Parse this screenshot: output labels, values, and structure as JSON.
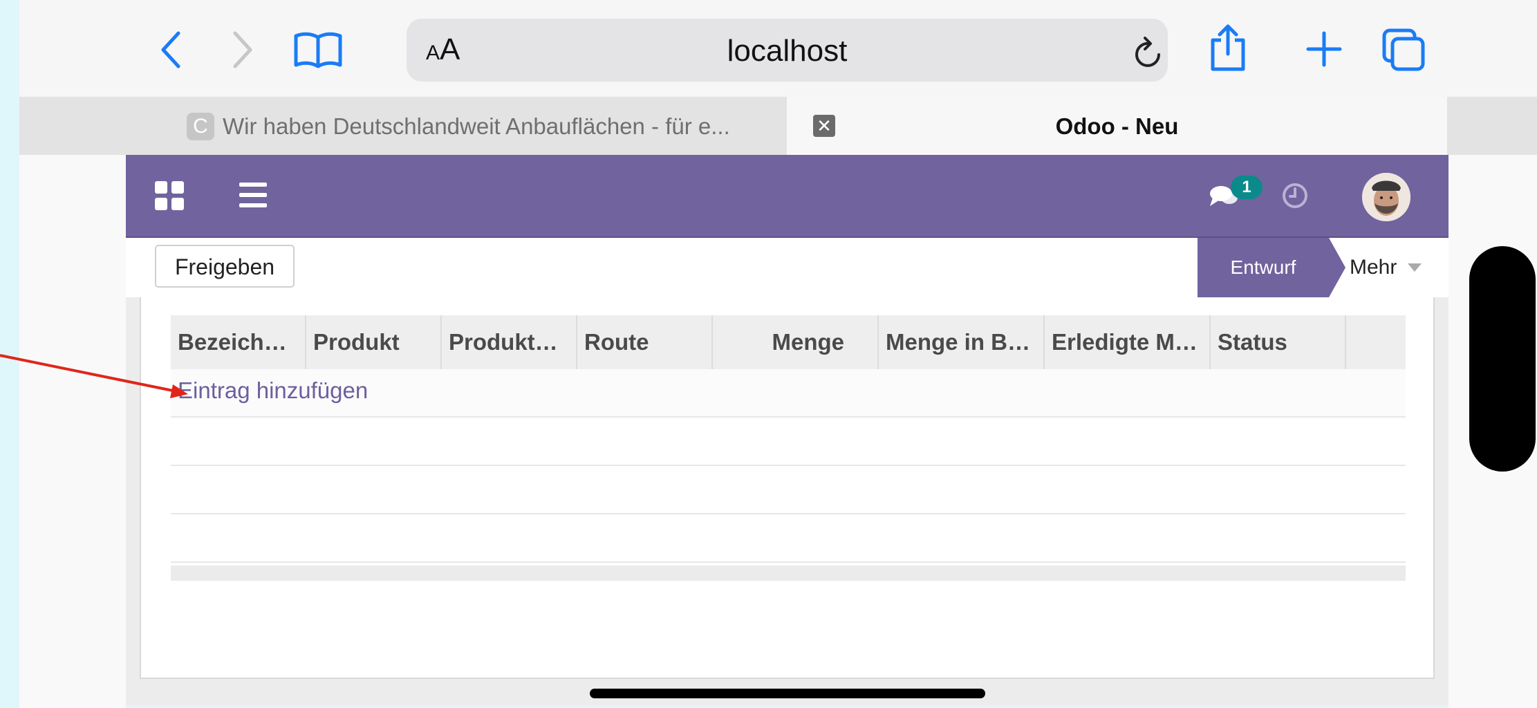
{
  "browser": {
    "url": "localhost",
    "aa_small": "A",
    "aa_large": "A",
    "tabs": [
      {
        "favicon_letter": "C",
        "title": "Wir haben Deutschlandweit Anbauflächen - für e..."
      },
      {
        "title": "Odoo - Neu"
      }
    ]
  },
  "odoo": {
    "messaging_badge": "1",
    "control": {
      "primary_button": "Freigeben",
      "status_active": "Entwurf",
      "status_more": "Mehr"
    },
    "table": {
      "columns": [
        "Bezeich…",
        "Produkt",
        "Produkt…",
        "Route",
        "Menge",
        "Menge in B…",
        "Erledigte M…",
        "Status"
      ],
      "add_line": "Eintrag hinzufügen"
    }
  },
  "colors": {
    "odoo_primary": "#71639e",
    "browser_accent": "#1a7cf5",
    "badge": "#0a8a8a",
    "annotation_arrow": "#e0261b"
  }
}
